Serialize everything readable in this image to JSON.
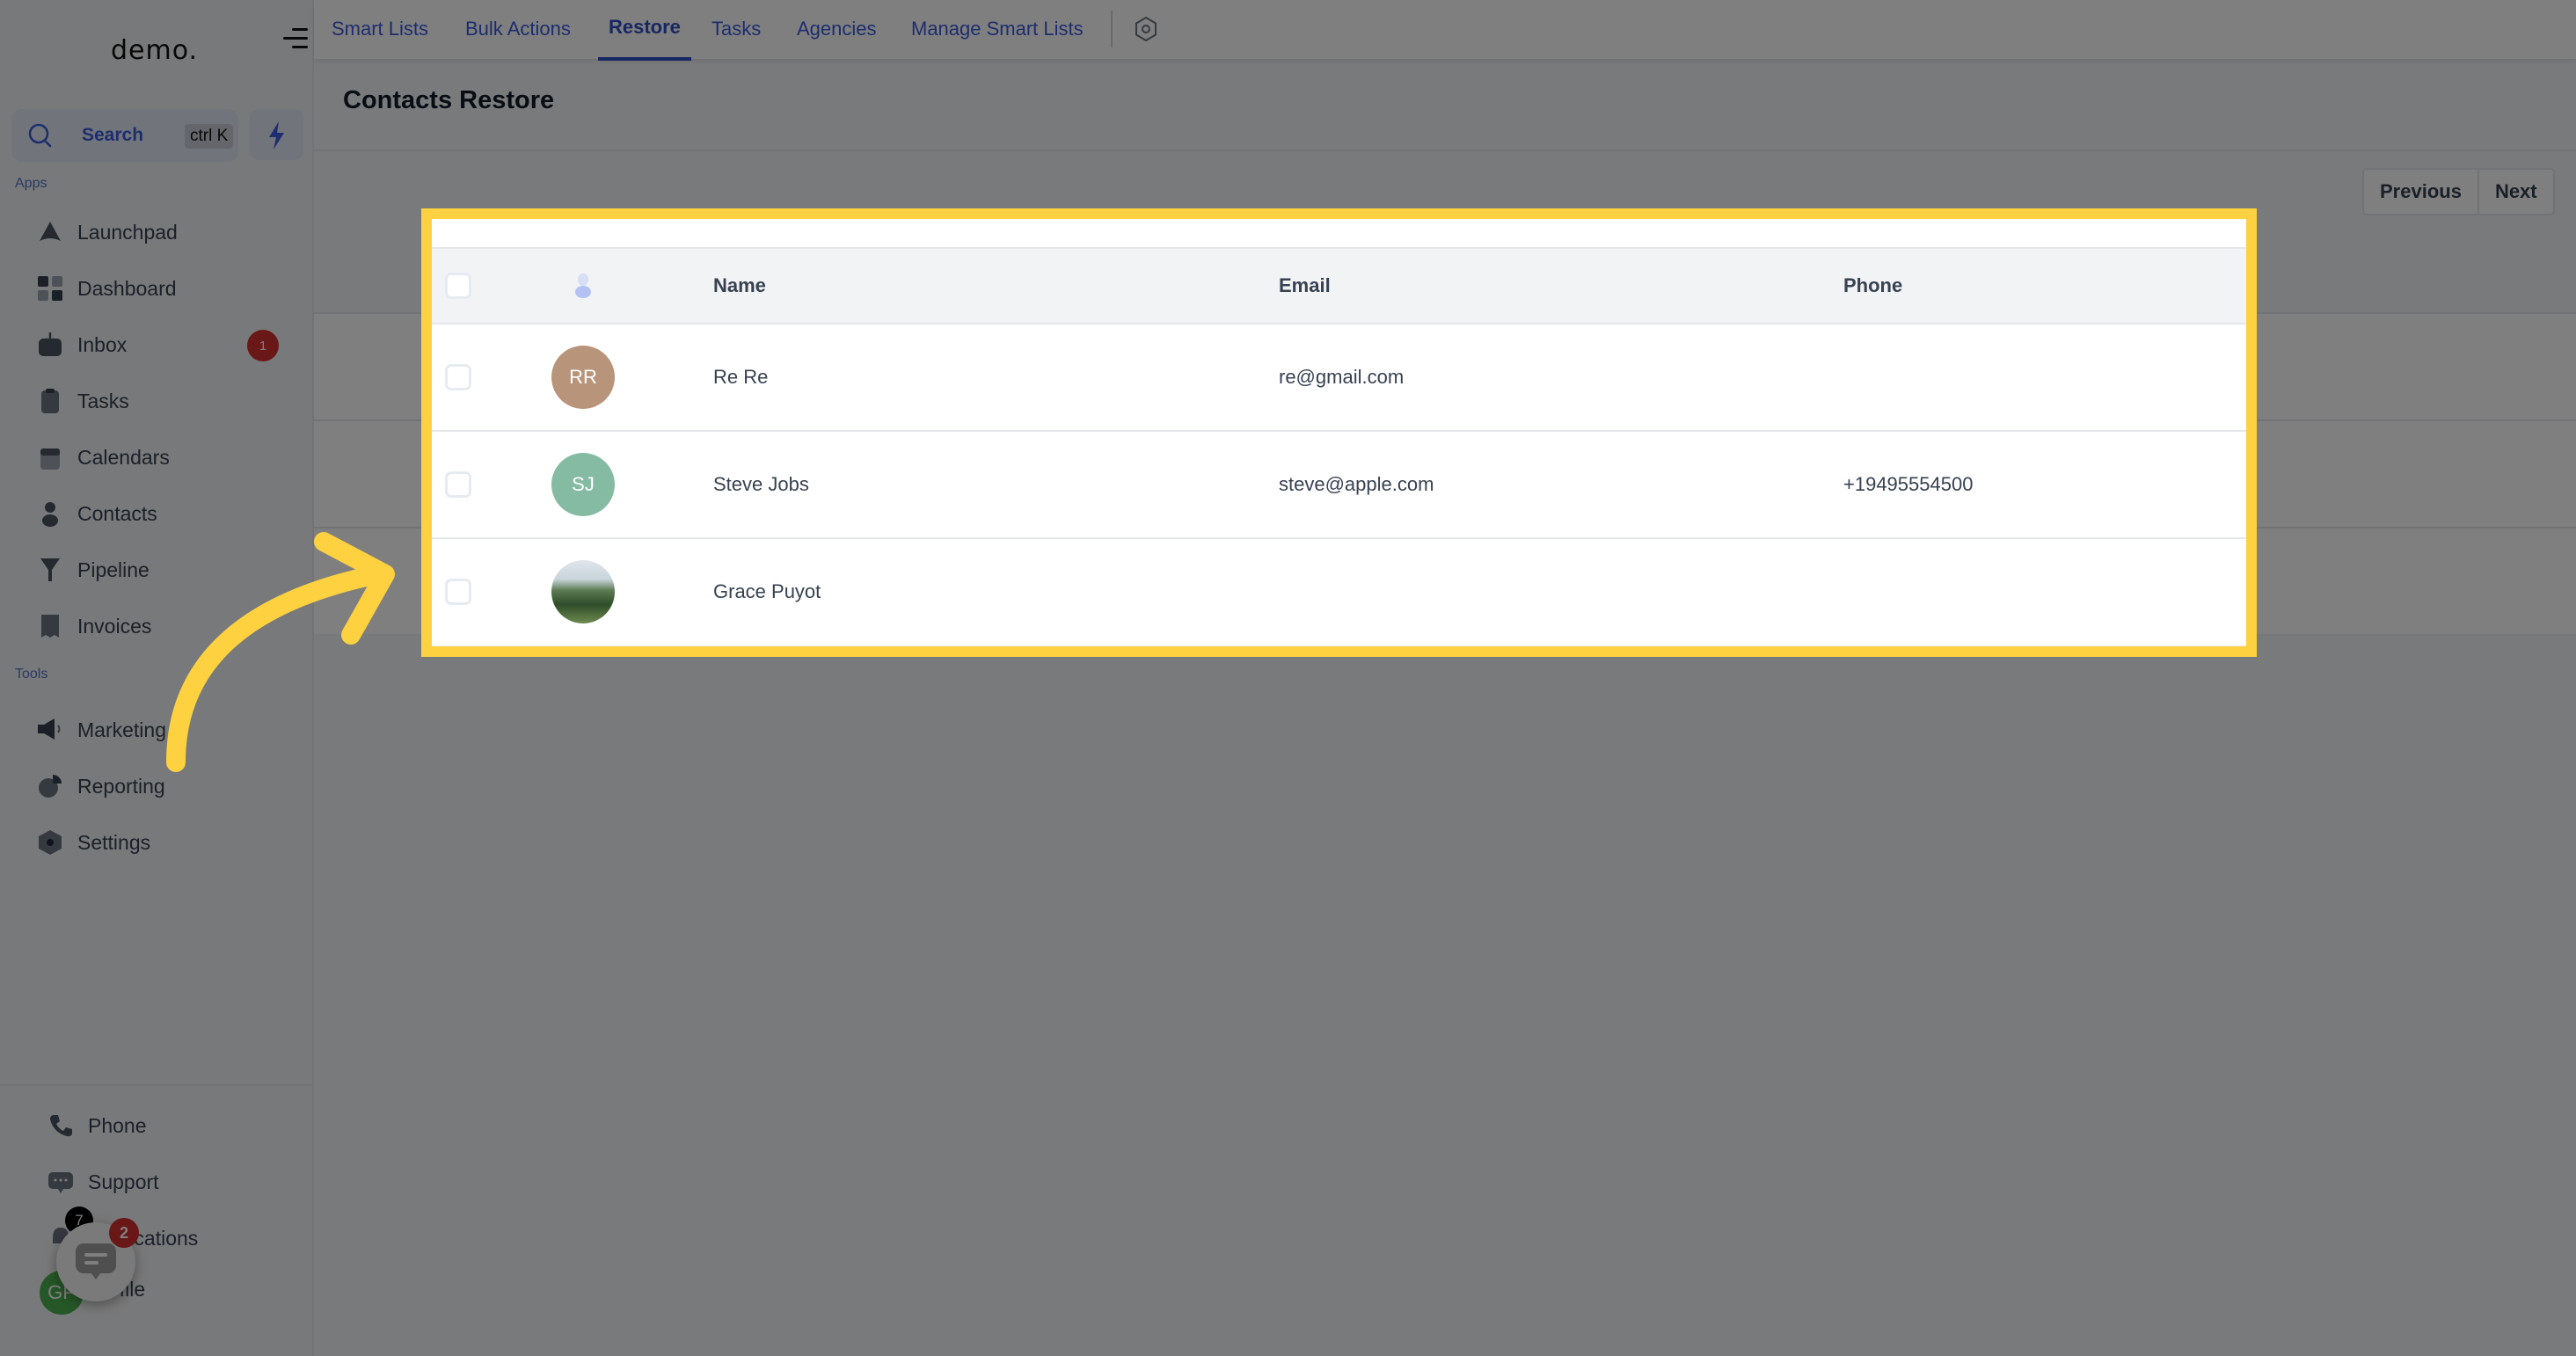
{
  "app": {
    "logo": "demo."
  },
  "sidebar": {
    "search": {
      "label": "Search",
      "shortcut": "ctrl K"
    },
    "sections": {
      "apps": "Apps",
      "tools": "Tools"
    },
    "apps": [
      {
        "label": "Launchpad",
        "icon": "rocket-icon"
      },
      {
        "label": "Dashboard",
        "icon": "dashboard-icon"
      },
      {
        "label": "Inbox",
        "icon": "inbox-icon",
        "badge": "1"
      },
      {
        "label": "Tasks",
        "icon": "tasks-icon"
      },
      {
        "label": "Calendars",
        "icon": "calendar-icon"
      },
      {
        "label": "Contacts",
        "icon": "contacts-icon"
      },
      {
        "label": "Pipeline",
        "icon": "pipeline-icon"
      },
      {
        "label": "Invoices",
        "icon": "invoice-icon"
      }
    ],
    "tools": [
      {
        "label": "Marketing",
        "icon": "megaphone-icon"
      },
      {
        "label": "Reporting",
        "icon": "pie-chart-icon"
      },
      {
        "label": "Settings",
        "icon": "settings-icon"
      }
    ],
    "bottom": [
      {
        "label": "Phone",
        "icon": "phone-icon"
      },
      {
        "label": "Support",
        "icon": "support-icon"
      },
      {
        "label": "Notifications",
        "icon": "bell-icon",
        "count": "7"
      },
      {
        "label": "Profile",
        "initials": "GP"
      }
    ],
    "chat_badge": "2"
  },
  "tabs": [
    {
      "label": "Smart Lists",
      "active": false
    },
    {
      "label": "Bulk Actions",
      "active": false
    },
    {
      "label": "Restore",
      "active": true
    },
    {
      "label": "Tasks",
      "active": false
    },
    {
      "label": "Agencies",
      "active": false
    },
    {
      "label": "Manage Smart Lists",
      "active": false
    }
  ],
  "page": {
    "title": "Contacts Restore"
  },
  "pagination": {
    "previous": "Previous",
    "next": "Next"
  },
  "table": {
    "columns": {
      "name": "Name",
      "email": "Email",
      "phone": "Phone"
    },
    "rows": [
      {
        "initials": "RR",
        "avatar_color": "#b8957a",
        "name": "Re Re",
        "email": "re@gmail.com",
        "phone": ""
      },
      {
        "initials": "SJ",
        "avatar_color": "#85bba3",
        "name": "Steve Jobs",
        "email": "steve@apple.com",
        "phone": "+19495554500"
      },
      {
        "initials": "",
        "avatar_color": "photo",
        "name": "Grace Puyot",
        "email": "",
        "phone": ""
      }
    ]
  },
  "colors": {
    "accent": "#3b5bdb",
    "highlight": "#fdd13f",
    "badge": "#d32f2f"
  }
}
